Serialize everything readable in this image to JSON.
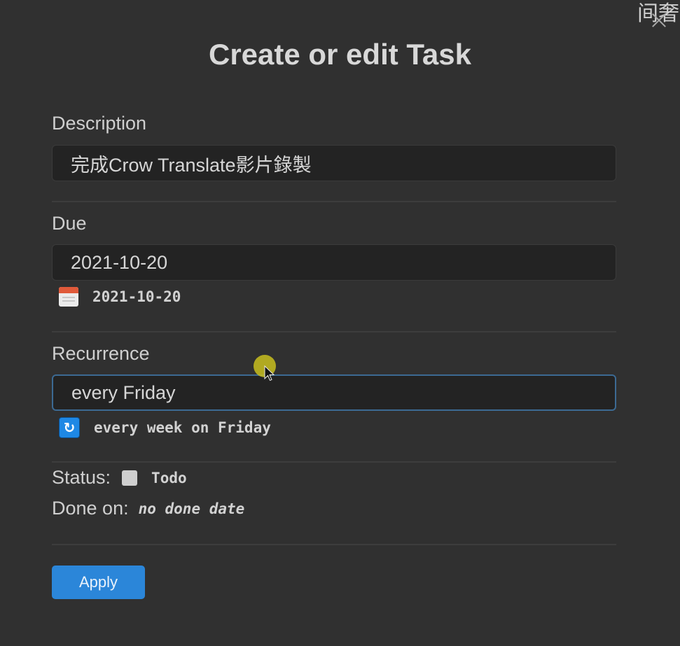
{
  "corner_text": "间奢",
  "title": "Create or edit Task",
  "description": {
    "label": "Description",
    "value": "完成Crow Translate影片錄製"
  },
  "due": {
    "label": "Due",
    "value": "2021-10-20",
    "parsed": "2021-10-20",
    "icon": "calendar-icon"
  },
  "recurrence": {
    "label": "Recurrence",
    "value": "every Friday",
    "parsed": "every week on Friday",
    "icon": "repeat-icon"
  },
  "status": {
    "label": "Status:",
    "value": "Todo"
  },
  "done_on": {
    "label": "Done on:",
    "value": "no done date"
  },
  "apply_label": "Apply",
  "colors": {
    "accent": "#2b86d9",
    "background": "#303030",
    "input_background": "#232323",
    "focus_border": "#3c6a93"
  }
}
